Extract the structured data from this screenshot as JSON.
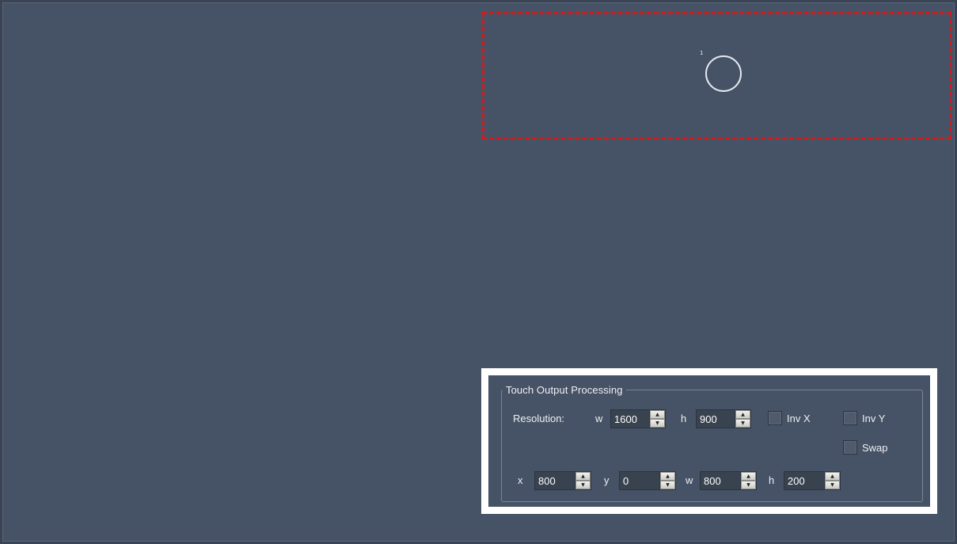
{
  "touch_area": {
    "point_id": "1"
  },
  "panel": {
    "title": "Touch Output Processing",
    "resolution": {
      "label": "Resolution:",
      "w_label": "w",
      "w_value": "1600",
      "h_label": "h",
      "h_value": "900"
    },
    "checkboxes": {
      "inv_x": "Inv X",
      "inv_y": "Inv Y",
      "swap": "Swap"
    },
    "region": {
      "x_label": "x",
      "x_value": "800",
      "y_label": "y",
      "y_value": "0",
      "w_label": "w",
      "w_value": "800",
      "h_label": "h",
      "h_value": "200"
    }
  },
  "colors": {
    "background": "#465265",
    "touch_region_border": "#d21c1c",
    "panel_highlight": "#ffffff"
  }
}
